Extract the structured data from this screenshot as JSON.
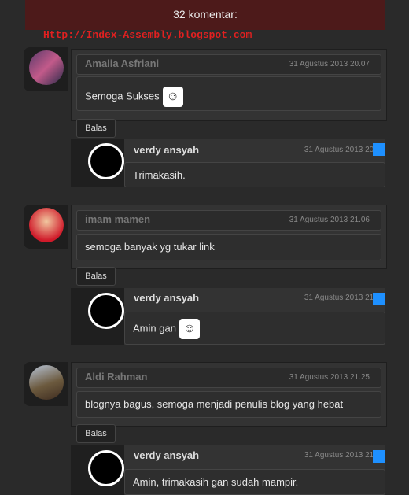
{
  "header": {
    "title": "32 komentar:"
  },
  "watermark": "Http://Index-Assembly.blogspot.com",
  "reply_label": "Balas",
  "comments": [
    {
      "author": "Amalia Asfriani",
      "date": "31 Agustus 2013 20.07",
      "text": "Semoga Sukses",
      "reply": {
        "author": "verdy ansyah",
        "date": "31 Agustus 2013 20.",
        "text": "Trimakasih."
      }
    },
    {
      "author": "imam mamen",
      "date": "31 Agustus 2013 21.06",
      "text": "semoga banyak yg tukar link",
      "reply": {
        "author": "verdy ansyah",
        "date": "31 Agustus 2013 21.",
        "text": "Amin gan"
      }
    },
    {
      "author": "Aldi Rahman",
      "date": "31 Agustus 2013 21.25",
      "text": "blognya bagus, semoga menjadi penulis blog yang hebat",
      "reply": {
        "author": "verdy ansyah",
        "date": "31 Agustus 2013 21.",
        "text": "Amin, trimakasih gan sudah mampir."
      }
    }
  ]
}
